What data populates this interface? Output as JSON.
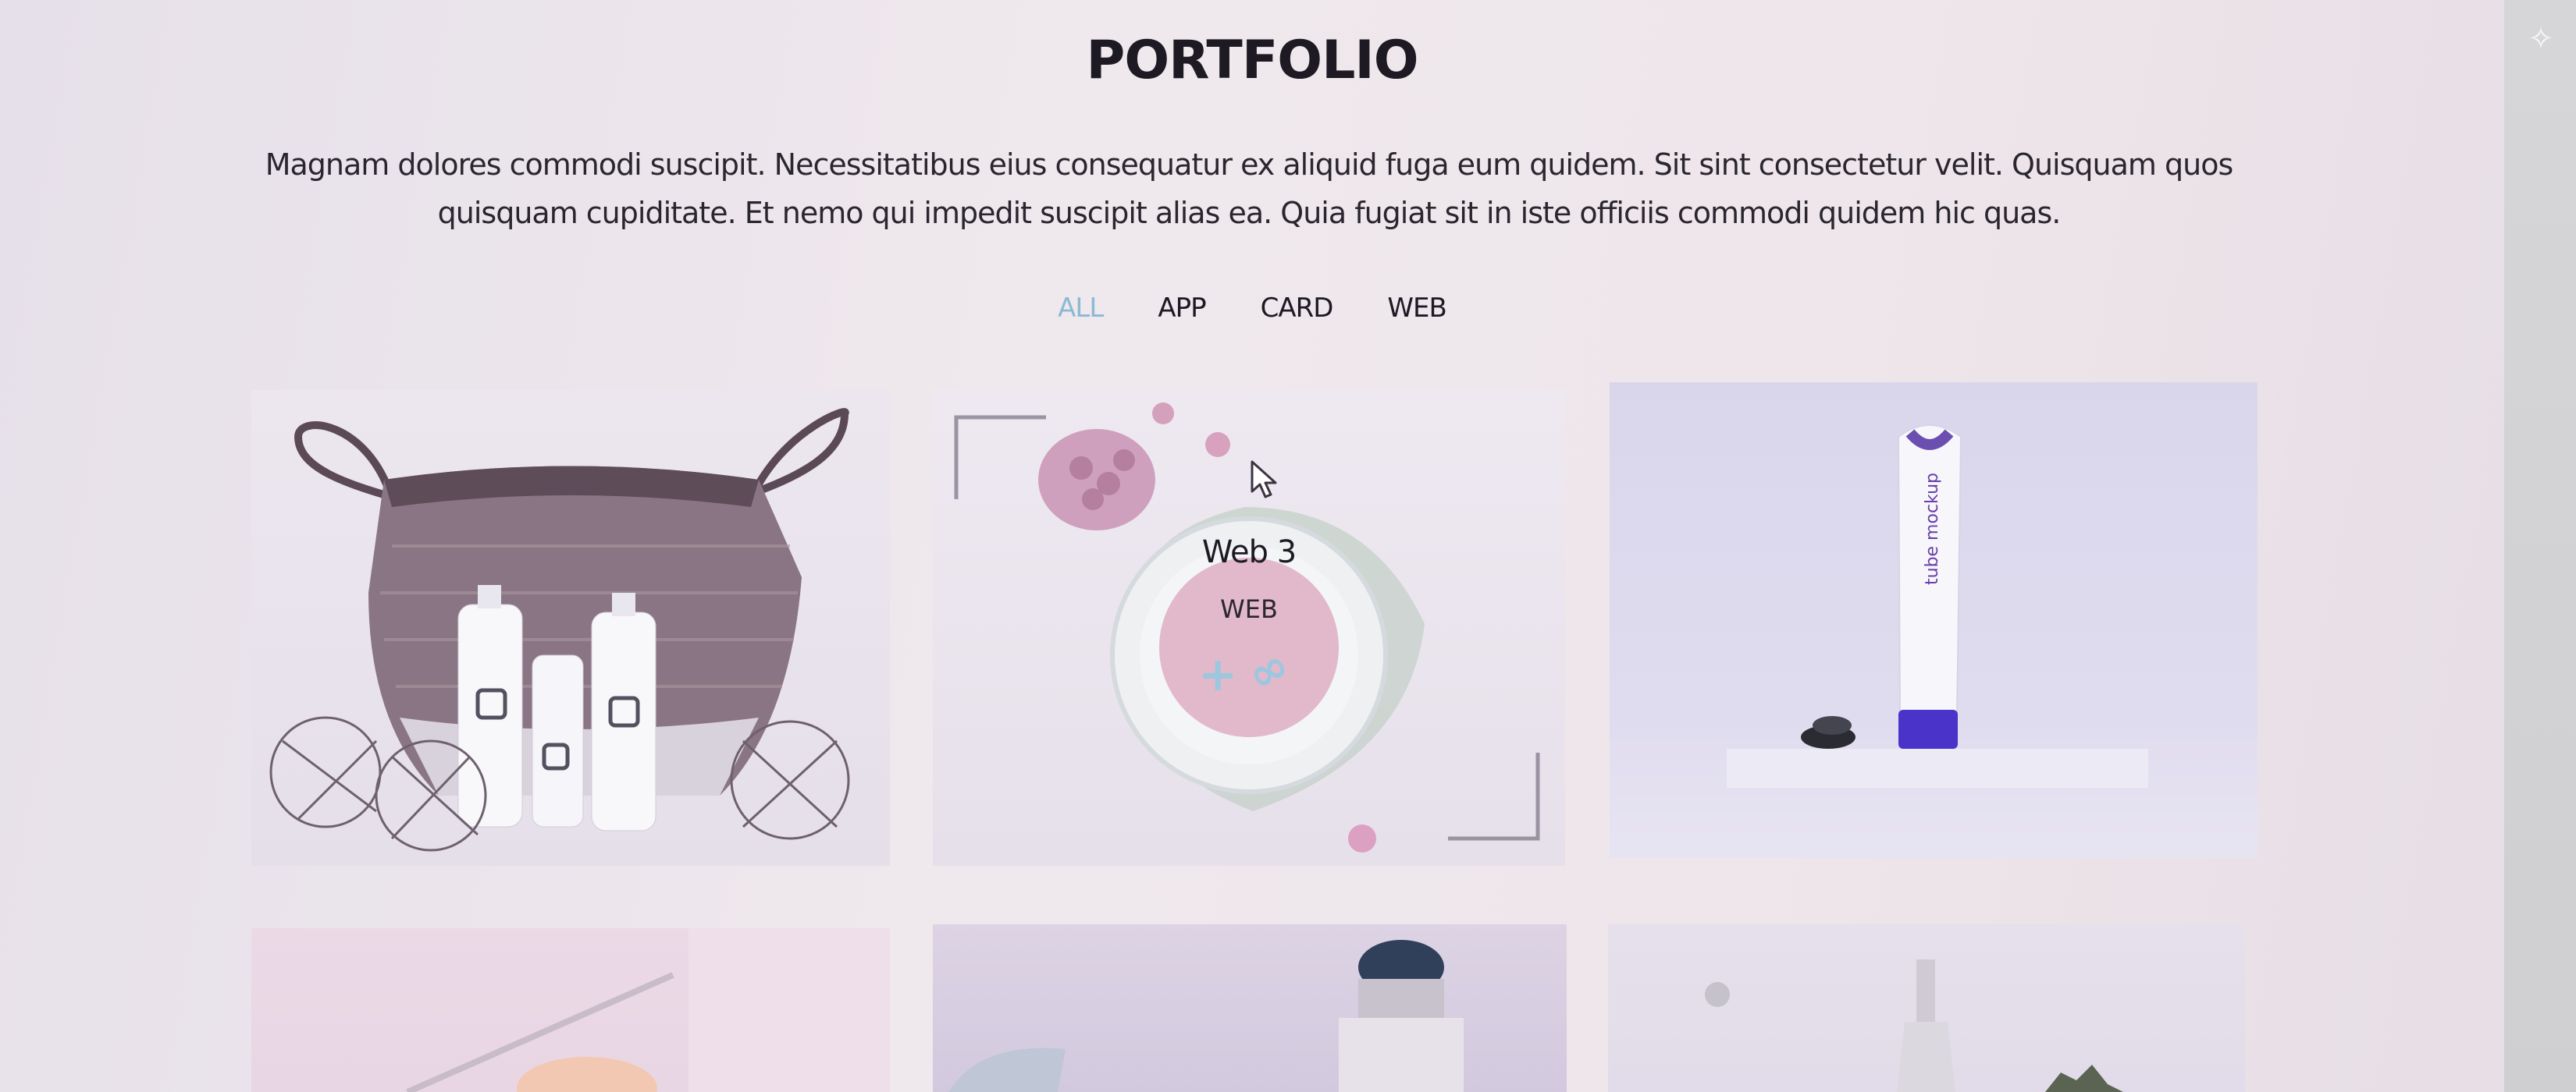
{
  "page": {
    "title": "PORTFOLIO",
    "description": "Magnam dolores commodi suscipit. Necessitatibus eius consequatur ex aliquid fuga eum quidem. Sit sint consectetur velit. Quisquam quos quisquam cupiditate. Et nemo qui impedit suscipit alias ea. Quia fugiat sit in iste officiis commodi quidem hic quas."
  },
  "filters": [
    {
      "label": "ALL",
      "active": true
    },
    {
      "label": "APP",
      "active": false
    },
    {
      "label": "CARD",
      "active": false
    },
    {
      "label": "WEB",
      "active": false
    }
  ],
  "portfolio_items": [
    {
      "icon": "basket-product-photo"
    },
    {
      "icon": "tea-cup-product-photo",
      "hover_overlay": {
        "title": "Web 3",
        "category": "WEB",
        "actions": [
          "plus-icon",
          "link-icon"
        ]
      }
    },
    {
      "icon": "tube-mockup-photo",
      "product_text": "tube mockup"
    },
    {
      "icon": "pink-desk-photo"
    },
    {
      "icon": "perfume-bottle-photo"
    },
    {
      "icon": "cosmetic-bottle-photo"
    }
  ],
  "colors": {
    "active_filter": "#8bbad6",
    "text": "#1e1a24",
    "background": "#ece6ec"
  }
}
